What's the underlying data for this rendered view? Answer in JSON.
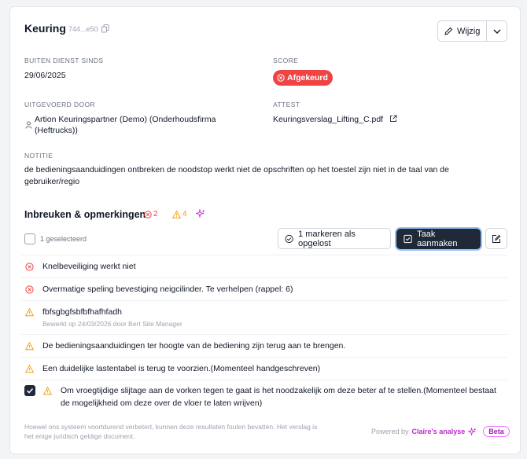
{
  "header": {
    "title": "Keuring",
    "id_short": "744...e50",
    "edit_label": "Wijzig"
  },
  "fields": {
    "buiten_dienst": {
      "label": "BUITEN DIENST SINDS",
      "value": "29/06/2025"
    },
    "score": {
      "label": "SCORE",
      "value": "Afgekeurd"
    },
    "uitgevoerd": {
      "label": "UITGEVOERD DOOR",
      "line1": "Artion Keuringspartner (Demo) (Onderhoudsfirma",
      "line2": "(Heftrucks))"
    },
    "attest": {
      "label": "ATTEST",
      "value": "Keuringsverslag_Lifting_C.pdf"
    },
    "notitie": {
      "label": "NOTITIE",
      "line1": "de bedieningsaanduidingen ontbreken de noodstop werkt niet de opschriften op het toestel zijn niet in de taal van de",
      "line2": "gebruiker/regio"
    }
  },
  "infractions": {
    "title": "Inbreuken & opmerkingen",
    "error_count": "2",
    "warning_count": "4",
    "selected_label": "1 geselecteerd",
    "mark_resolved_label": "1 markeren als opgelost",
    "create_task_label": "Taak aanmaken",
    "items": [
      {
        "type": "error",
        "text": "Knelbeveiliging werkt niet"
      },
      {
        "type": "error",
        "text": "Overmatige speling bevestiging neigcilinder. Te verhelpen (rappel: 6)"
      },
      {
        "type": "warning",
        "text": "fbfsgbgfsbfbfhafhfadh",
        "sub": "Bewerkt op 24/03/2026 door Bert Site Manager"
      },
      {
        "type": "warning",
        "text": "De bedieningsaanduidingen ter hoogte van de bediening zijn terug aan te brengen."
      },
      {
        "type": "warning",
        "text": "Een duidelijke lastentabel is terug te voorzien.(Momenteel handgeschreven)"
      },
      {
        "type": "warning",
        "checked": true,
        "line1": "Om vroegtijdige slijtage aan de vorken tegen te gaat is het noodzakelijk om deze beter af te stellen.(Momenteel bestaat",
        "line2": "de mogelijkheid om deze over de vloer te laten wrijven)"
      }
    ]
  },
  "footer": {
    "note_line1": "Hoewel ons systeem voortdurend verbetert, kunnen deze resultaten fouten bevatten. Het verslag is",
    "note_line2": "het enige juridisch geldige document.",
    "powered_by": "Powered by",
    "brand": "Claire's analyse",
    "beta": "Beta"
  },
  "colors": {
    "error": "#ef4444",
    "warning": "#f59e0b",
    "brand": "#c026d3",
    "dark_button": "#1f2937"
  }
}
